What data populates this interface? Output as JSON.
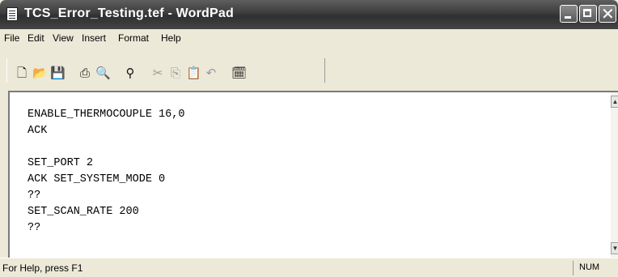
{
  "window": {
    "title": "TCS_Error_Testing.tef - WordPad"
  },
  "menu": [
    "File",
    "Edit",
    "View",
    "Insert",
    "Format",
    "Help"
  ],
  "toolbar": [
    "new-document",
    "open",
    "save",
    "print",
    "print-preview",
    "find",
    "cut",
    "copy",
    "paste",
    "undo",
    "insert-date-time"
  ],
  "document": {
    "lines": [
      "ENABLE_THERMOCOUPLE 16,0",
      "ACK",
      "",
      "SET_PORT 2",
      "ACK SET_SYSTEM_MODE 0",
      "??",
      "SET_SCAN_RATE 200",
      "??"
    ]
  },
  "status": {
    "help_text": "For Help, press F1",
    "num_indicator": "NUM"
  }
}
